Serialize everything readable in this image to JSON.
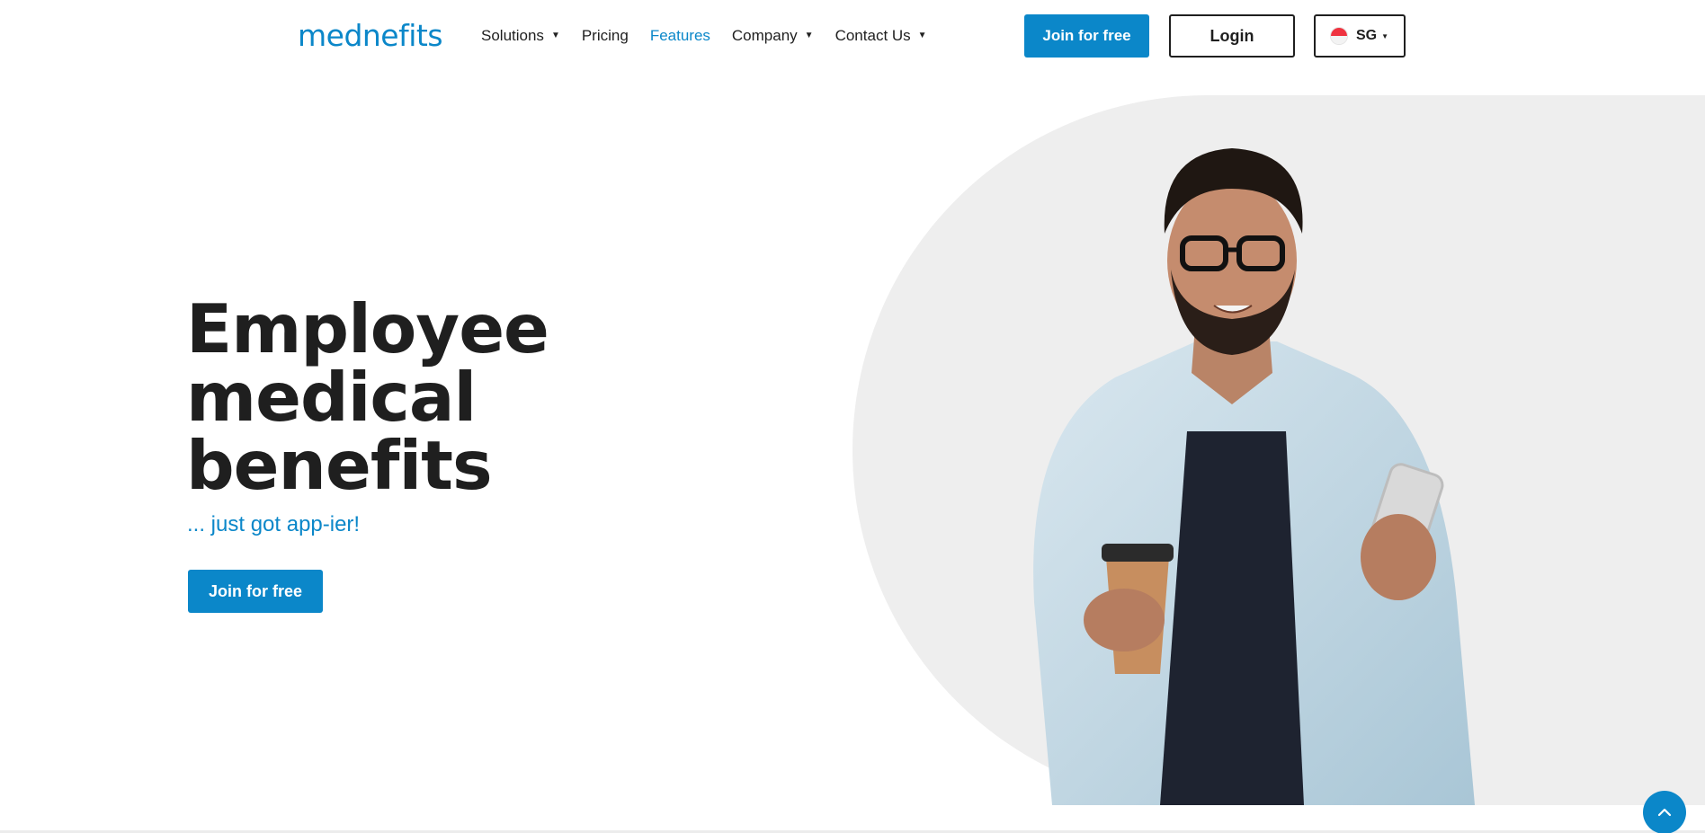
{
  "header": {
    "logo": "mednefits",
    "nav": [
      {
        "label": "Solutions",
        "dropdown": true
      },
      {
        "label": "Pricing",
        "dropdown": false
      },
      {
        "label": "Features",
        "dropdown": false,
        "active": true
      },
      {
        "label": "Company",
        "dropdown": true
      },
      {
        "label": "Contact Us",
        "dropdown": true
      }
    ],
    "join_label": "Join for free",
    "login_label": "Login",
    "country_code": "SG"
  },
  "hero": {
    "title_lines": [
      "Employee",
      "medical",
      "benefits"
    ],
    "subtitle": "... just got app-ier!",
    "cta_label": "Join for free"
  },
  "icons": {
    "dropdown": "caret-down-icon",
    "scroll_top": "chevron-up-icon",
    "flag": "singapore-flag-icon"
  },
  "colors": {
    "brand": "#0b87c9",
    "text": "#1f1f1f",
    "hero_bg": "#eeeeee"
  }
}
